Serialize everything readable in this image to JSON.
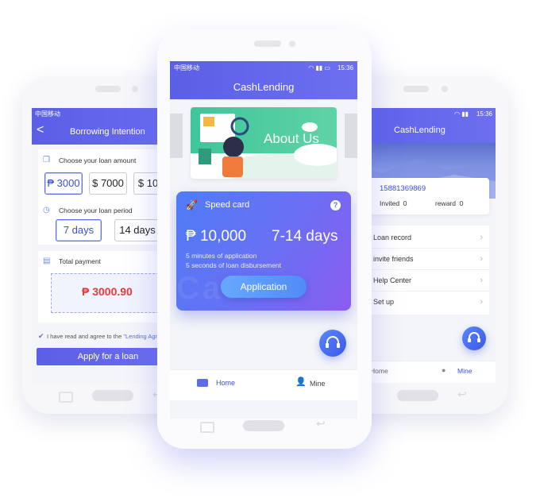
{
  "left_phone": {
    "status": {
      "carrier": "中国移动"
    },
    "header": {
      "back": "<",
      "title": "Borrowing Intention"
    },
    "amount": {
      "label": "Choose your loan amount",
      "options": [
        "₱ 3000",
        "$ 7000",
        "$ 10,0"
      ]
    },
    "period": {
      "label": "Choose your loan period",
      "options": [
        "7 days",
        "14 days"
      ]
    },
    "total": {
      "label": "Total payment",
      "value": "₱ 3000.90"
    },
    "agree": {
      "text": "I have read and agree to the ",
      "link": "\"Lending Agr"
    },
    "apply_button": "Apply for a loan"
  },
  "center_phone": {
    "status": {
      "carrier": "中国移动",
      "time": "15:36"
    },
    "header": {
      "title": "CashLending"
    },
    "banner": {
      "text": "About Us"
    },
    "speed_card": {
      "title": "Speed card",
      "help": "?",
      "amount": "₱ 10,000",
      "period": "7-14 days",
      "line1": "5 minutes of application",
      "line2": "5 seconds of loan disbursement",
      "watermark": "Cash",
      "button": "Application"
    },
    "tabs": {
      "home": "Home",
      "mine": "Mine"
    }
  },
  "right_phone": {
    "status": {
      "time": "15:36"
    },
    "header": {
      "title": "CashLending"
    },
    "profile": {
      "phone": "15881369869",
      "invited_label": "Invited",
      "invited_value": "0",
      "reward_label": "reward",
      "reward_value": "0"
    },
    "menu": [
      "Loan record",
      "invite friends",
      "Help Center",
      "Set up"
    ],
    "tabs": {
      "home": "Home",
      "mine": "Mine"
    }
  },
  "colors": {
    "primary": "#5a5fe6",
    "accent_red": "#e43b3b",
    "card_gradient_start": "#4f7cf7",
    "card_gradient_end": "#8a5cf0"
  }
}
